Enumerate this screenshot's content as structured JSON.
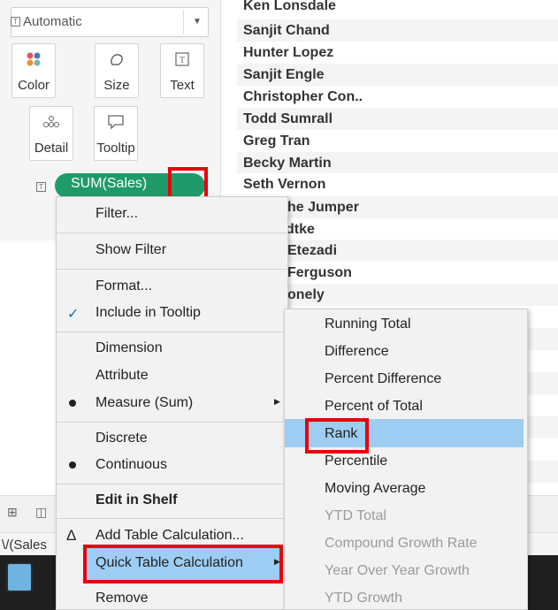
{
  "marks_card": {
    "mark_type": "Automatic",
    "buttons": [
      {
        "label": "Color",
        "icon": "color-dots-icon"
      },
      {
        "label": "Size",
        "icon": "size-icon"
      },
      {
        "label": "Text",
        "icon": "text-icon"
      },
      {
        "label": "Detail",
        "icon": "detail-icon"
      },
      {
        "label": "Tooltip",
        "icon": "tooltip-icon"
      }
    ],
    "pill_label": "SUM(Sales)",
    "pill_icon": "text-icon"
  },
  "names": [
    "Ken Lonsdale",
    "Sanjit Chand",
    "Hunter Lopez",
    "Sanjit Engle",
    "Christopher Con..",
    "Todd Sumrall",
    "Greg Tran",
    "Becky Martin",
    "Seth Vernon",
    "he Jumper",
    "dtke",
    "Etezadi",
    "Ferguson",
    "onely"
  ],
  "context_menu": {
    "filter": "Filter...",
    "show_filter": "Show Filter",
    "format": "Format...",
    "include_in_tooltip": "Include in Tooltip",
    "dimension": "Dimension",
    "attribute": "Attribute",
    "measure": "Measure (Sum)",
    "discrete": "Discrete",
    "continuous": "Continuous",
    "edit_in_shelf": "Edit in Shelf",
    "add_table_calc": "Add Table Calculation...",
    "quick_table_calc": "Quick Table Calculation",
    "remove": "Remove"
  },
  "submenu": {
    "running_total": "Running Total",
    "difference": "Difference",
    "percent_difference": "Percent Difference",
    "percent_of_total": "Percent of Total",
    "rank": "Rank",
    "percentile": "Percentile",
    "moving_average": "Moving Average",
    "ytd_total": "YTD Total",
    "compound_growth_rate": "Compound Growth Rate",
    "yoy_growth": "Year Over Year Growth",
    "ytd_growth": "YTD Growth"
  },
  "bottom": {
    "shelf_label": "\\/(Sales"
  },
  "colors": {
    "pill_green": "#1f9b69",
    "highlight_blue": "#9dcdf2",
    "annotation_red": "#e8000b"
  }
}
